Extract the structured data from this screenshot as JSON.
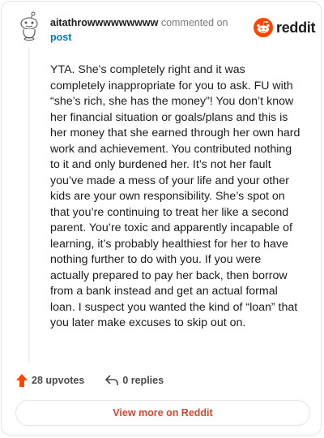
{
  "header": {
    "username": "aitathrowwwwwwwww",
    "action": "commented on",
    "post_link": "post",
    "brand": "reddit"
  },
  "comment": {
    "text": "YTA. She’s completely right and it was completely inappropriate for you to ask. FU with “she’s rich, she has the money”! You don’t know her financial situation or goals/plans and this is her money that she earned through her own hard work and achievement. You contributed nothing to it and only burdened her. It’s not her fault you’ve made a mess of your life and your other kids are your own responsibility. She’s spot on that you’re continuing to treat her like a second parent. You’re toxic and apparently incapable of learning, it’s probably healthiest for her to have nothing further to do with you. If you were actually prepared to pay her back, then borrow from a bank instead and get an actual formal loan. I suspect you wanted the kind of “loan” that you later make excuses to skip out on."
  },
  "footer": {
    "upvotes": "28 upvotes",
    "replies": "0 replies",
    "view_more": "View more on Reddit"
  },
  "colors": {
    "brand_orange": "#ff4500",
    "link_blue": "#0079d3",
    "view_more_red": "#d14a2f"
  },
  "icons": {
    "avatar": "snoo-avatar-icon",
    "logo": "reddit-logo-icon",
    "upvote": "upvote-arrow-icon",
    "reply": "reply-arrow-icon"
  }
}
